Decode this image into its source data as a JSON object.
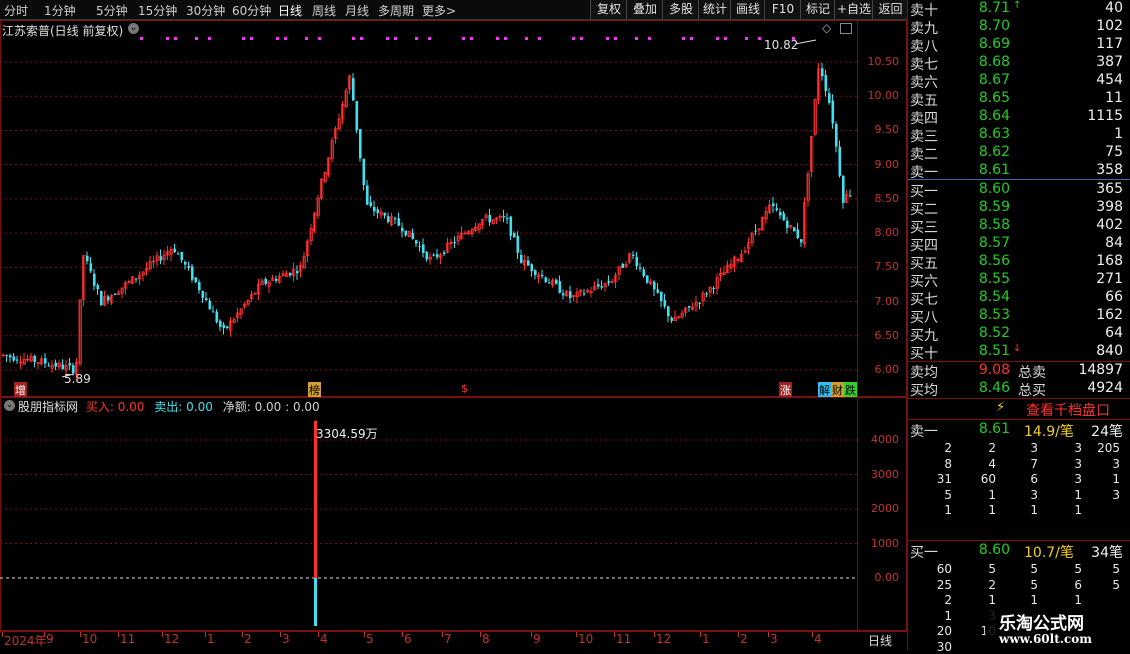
{
  "toolbar": {
    "periods": [
      "分时",
      "1分钟",
      "5分钟",
      "15分钟",
      "30分钟",
      "60分钟",
      "日线",
      "周线",
      "月线",
      "多周期",
      "更多"
    ],
    "active_period": "日线",
    "more_arrow": ">",
    "buttons": [
      "复权",
      "叠加",
      "多股",
      "统计",
      "画线",
      "F10",
      "标记",
      "+自选",
      "返回"
    ]
  },
  "main_chart": {
    "title": "江苏索普(日线 前复权)",
    "high_label": "10.82",
    "low_label": "5.89",
    "y_ticks": [
      "10.50",
      "10.00",
      "9.50",
      "9.00",
      "8.50",
      "8.00",
      "7.50",
      "7.00",
      "6.50",
      "6.00"
    ],
    "markers": [
      "增",
      "榜",
      "$",
      "涨",
      "解",
      "财",
      "跌"
    ]
  },
  "indicator": {
    "name": "股朋指标网",
    "buy_label": "买入:",
    "buy_value": "0.00",
    "sell_label": "卖出:",
    "sell_value": "0.00",
    "net_label": "净额:",
    "net_value": "0.00 : 0.00",
    "bar_label": "3304.59万",
    "y_ticks": [
      "4000",
      "3000",
      "2000",
      "1000",
      "0.00"
    ]
  },
  "x_axis": {
    "labels": [
      "2024年",
      "9",
      "10",
      "11",
      "12",
      "1",
      "2",
      "3",
      "4",
      "5",
      "6",
      "7",
      "8",
      "9",
      "10",
      "11",
      "12",
      "1",
      "2",
      "3",
      "4"
    ],
    "period_label": "日线"
  },
  "order_book": {
    "asks": [
      {
        "label": "卖十",
        "price": "8.71",
        "vol": "40",
        "flag": "↑"
      },
      {
        "label": "卖九",
        "price": "8.70",
        "vol": "102"
      },
      {
        "label": "卖八",
        "price": "8.69",
        "vol": "117"
      },
      {
        "label": "卖七",
        "price": "8.68",
        "vol": "387"
      },
      {
        "label": "卖六",
        "price": "8.67",
        "vol": "454"
      },
      {
        "label": "卖五",
        "price": "8.65",
        "vol": "11"
      },
      {
        "label": "卖四",
        "price": "8.64",
        "vol": "1115"
      },
      {
        "label": "卖三",
        "price": "8.63",
        "vol": "1"
      },
      {
        "label": "卖二",
        "price": "8.62",
        "vol": "75"
      },
      {
        "label": "卖一",
        "price": "8.61",
        "vol": "358"
      }
    ],
    "bids": [
      {
        "label": "买一",
        "price": "8.60",
        "vol": "365"
      },
      {
        "label": "买二",
        "price": "8.59",
        "vol": "398"
      },
      {
        "label": "买三",
        "price": "8.58",
        "vol": "402"
      },
      {
        "label": "买四",
        "price": "8.57",
        "vol": "84"
      },
      {
        "label": "买五",
        "price": "8.56",
        "vol": "168"
      },
      {
        "label": "买六",
        "price": "8.55",
        "vol": "271"
      },
      {
        "label": "买七",
        "price": "8.54",
        "vol": "66"
      },
      {
        "label": "买八",
        "price": "8.53",
        "vol": "162"
      },
      {
        "label": "买九",
        "price": "8.52",
        "vol": "64"
      },
      {
        "label": "买十",
        "price": "8.51",
        "vol": "840",
        "flag": "↓"
      }
    ],
    "avg_sell_label": "卖均",
    "avg_sell_price": "9.08",
    "total_sell_label": "总卖",
    "total_sell": "14897",
    "avg_buy_label": "买均",
    "avg_buy_price": "8.46",
    "total_buy_label": "总买",
    "total_buy": "4924"
  },
  "level2": {
    "button_label": "查看千档盘口",
    "sell1": {
      "label": "卖一",
      "price": "8.61",
      "per": "14.9/笔",
      "count": "24笔"
    },
    "sell_grid": [
      [
        "2",
        "2",
        "3",
        "3",
        "205"
      ],
      [
        "8",
        "4",
        "7",
        "3",
        "3"
      ],
      [
        "31",
        "60",
        "6",
        "3",
        "1"
      ],
      [
        "5",
        "1",
        "3",
        "1",
        "3"
      ],
      [
        "1",
        "1",
        "1",
        "1",
        ""
      ]
    ],
    "buy1": {
      "label": "买一",
      "price": "8.60",
      "per": "10.7/笔",
      "count": "34笔"
    },
    "buy_grid": [
      [
        "60",
        "5",
        "5",
        "5",
        "5"
      ],
      [
        "25",
        "2",
        "5",
        "6",
        "5"
      ],
      [
        "2",
        "1",
        "1",
        "1",
        ""
      ],
      [
        "1",
        "3",
        "",
        "",
        ""
      ],
      [
        "20",
        "10",
        "",
        "",
        ""
      ],
      [
        "30",
        "",
        "",
        "",
        ""
      ]
    ]
  },
  "watermark": {
    "title": "乐淘公式网",
    "url": "www.60lt.com"
  },
  "colors": {
    "up": "#ff3030",
    "down": "#40e0f0",
    "grid": "#7a1010",
    "ask_price": "#20d020",
    "magenta": "#ff30ff"
  }
}
